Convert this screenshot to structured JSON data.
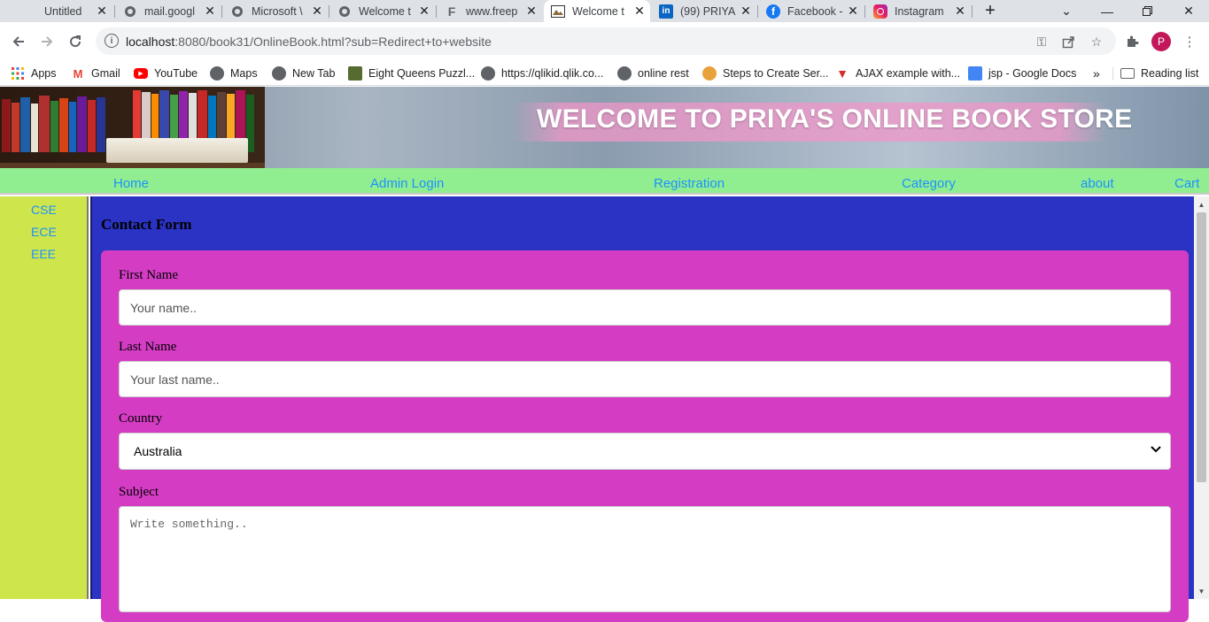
{
  "browser": {
    "tabs": [
      {
        "label": "Untitled",
        "icon": "blank-page-icon"
      },
      {
        "label": "mail.googl",
        "icon": "globe-icon"
      },
      {
        "label": "Microsoft \\",
        "icon": "globe-icon"
      },
      {
        "label": "Welcome t",
        "icon": "globe-icon"
      },
      {
        "label": "www.freep",
        "icon": "freepik-icon"
      },
      {
        "label": "Welcome t",
        "icon": "book-favicon-icon",
        "active": true
      },
      {
        "label": "(99) PRIYA",
        "icon": "linkedin-icon"
      },
      {
        "label": "Facebook -",
        "icon": "facebook-icon"
      },
      {
        "label": "Instagram",
        "icon": "instagram-icon"
      }
    ],
    "url_host": "localhost",
    "url_rest": ":8080/book31/OnlineBook.html?sub=Redirect+to+website",
    "avatar_letter": "P",
    "bookmarks": [
      {
        "label": "Apps",
        "icon": "apps-grid-icon"
      },
      {
        "label": "Gmail",
        "icon": "gmail-icon"
      },
      {
        "label": "YouTube",
        "icon": "youtube-icon"
      },
      {
        "label": "Maps",
        "icon": "globe-icon"
      },
      {
        "label": "New Tab",
        "icon": "globe-icon"
      },
      {
        "label": "Eight Queens Puzzl...",
        "icon": "puzzle-icon"
      },
      {
        "label": "https://qlikid.qlik.co...",
        "icon": "globe-icon"
      },
      {
        "label": "online rest",
        "icon": "globe-icon"
      },
      {
        "label": "Steps to Create Ser...",
        "icon": "tutorial-icon"
      },
      {
        "label": "AJAX example with...",
        "icon": "ajax-icon"
      },
      {
        "label": "jsp - Google Docs",
        "icon": "docs-icon"
      }
    ],
    "more_bookmarks": "»",
    "reading_list": "Reading list"
  },
  "site": {
    "banner_title": "WELCOME TO PRIYA'S ONLINE BOOK STORE",
    "menu": [
      "Home",
      "Admin Login",
      "Registration",
      "Category",
      "about",
      "Cart"
    ],
    "sidebar": [
      "CSE",
      "ECE",
      "EEE"
    ]
  },
  "form": {
    "heading": "Contact Form",
    "first_name_label": "First Name",
    "first_name_placeholder": "Your name..",
    "last_name_label": "Last Name",
    "last_name_placeholder": "Your last name..",
    "country_label": "Country",
    "country_value": "Australia",
    "subject_label": "Subject",
    "subject_placeholder": "Write something.."
  },
  "colors": {
    "menu_bg": "#90ee90",
    "link": "#1e90ff",
    "sidebar_bg": "#cee64b",
    "main_bg": "#2a33c4",
    "form_bg": "#d53cc4"
  }
}
